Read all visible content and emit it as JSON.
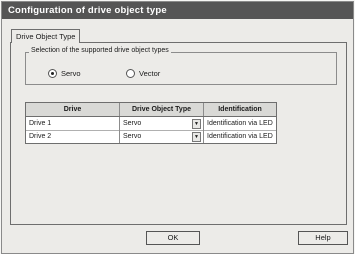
{
  "window": {
    "title": "Configuration of drive object type"
  },
  "tabs": [
    {
      "label": "Drive Object Type",
      "active": true
    }
  ],
  "group": {
    "title": "Selection of the supported drive object types",
    "options": [
      {
        "label": "Servo",
        "selected": true
      },
      {
        "label": "Vector",
        "selected": false
      }
    ]
  },
  "table": {
    "headers": [
      "Drive",
      "Drive Object Type",
      "Identification"
    ],
    "rows": [
      {
        "drive": "Drive 1",
        "type": "Servo",
        "identification": "Identification via LED"
      },
      {
        "drive": "Drive 2",
        "type": "Servo",
        "identification": "Identification via LED"
      }
    ]
  },
  "buttons": {
    "ok": "OK",
    "help": "Help"
  },
  "colors": {
    "titlebar": "#555555",
    "window": "#ecebe8"
  },
  "icons": {
    "dropdown": "chevron-down-icon"
  }
}
